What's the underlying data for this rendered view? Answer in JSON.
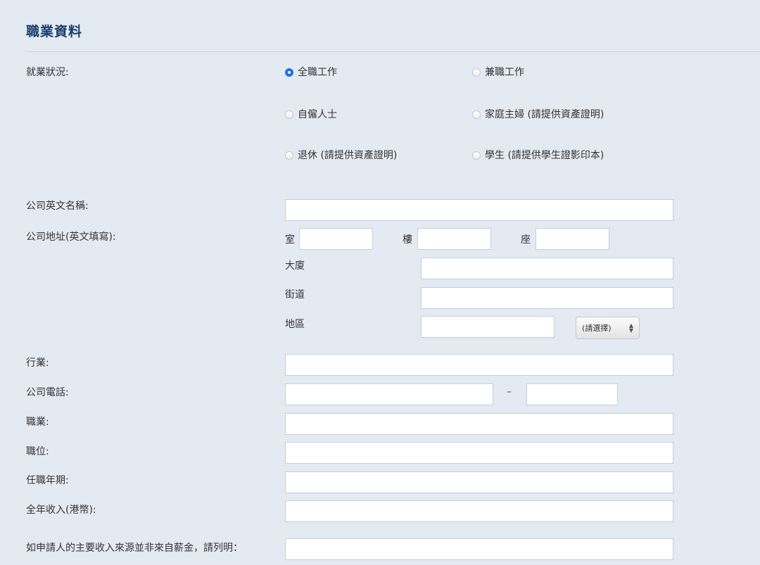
{
  "section_title": "職業資料",
  "employment": {
    "label": "就業狀況:",
    "options": [
      {
        "label": "全職工作",
        "selected": true
      },
      {
        "label": "兼職工作",
        "selected": false
      },
      {
        "label": "自僱人士",
        "selected": false
      },
      {
        "label": "家庭主婦 (請提供資產證明)",
        "selected": false
      },
      {
        "label": "退休 (請提供資產證明)",
        "selected": false
      },
      {
        "label": "學生 (請提供學生證影印本)",
        "selected": false
      }
    ]
  },
  "company_name": {
    "label": "公司英文名稱:",
    "value": ""
  },
  "address": {
    "label": "公司地址(英文填寫):",
    "room_label": "室",
    "room_value": "",
    "floor_label": "樓",
    "floor_value": "",
    "block_label": "座",
    "block_value": "",
    "building_label": "大廈",
    "building_value": "",
    "street_label": "街道",
    "street_value": "",
    "district_label": "地區",
    "district_value": "",
    "region_select": "(請選擇)"
  },
  "industry": {
    "label": "行業:",
    "value": ""
  },
  "phone": {
    "label": "公司電話:",
    "separator": "–",
    "value1": "",
    "value2": ""
  },
  "occupation": {
    "label": "職業:",
    "value": ""
  },
  "position": {
    "label": "職位:",
    "value": ""
  },
  "tenure": {
    "label": "任職年期:",
    "value": ""
  },
  "annual_income": {
    "label": "全年收入(港幣):",
    "value": ""
  },
  "other_income": {
    "label": "如申請人的主要收入來源並非來自薪金，請列明：",
    "value": ""
  },
  "colors": {
    "accent": "#1a73e8",
    "title": "#1c3f6e",
    "background": "#e4eaf2"
  }
}
